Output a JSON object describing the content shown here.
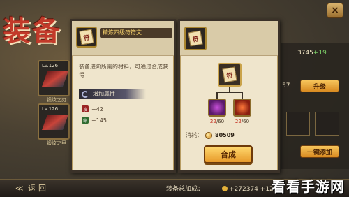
{
  "background": {
    "title": "装备",
    "close_symbol": "×",
    "slots": [
      {
        "level": "Lv.126",
        "name": "锻纹之刃"
      },
      {
        "level": "Lv.126",
        "name": "锻纹之甲"
      }
    ],
    "right_value": "3745",
    "right_value_bonus": "+19",
    "right_mid_value": "57",
    "upgrade_button": "升级",
    "equip_all_button": "一键添加"
  },
  "bottom_bar": {
    "back_label": "返回",
    "back_arrow": "≪",
    "bonus_label": "装备总加成：",
    "bonus_value": "+272374",
    "bonus_extra": "+12"
  },
  "watermark": "看看手游网",
  "item_panel": {
    "item_name": "精炼四级符符文",
    "icon_glyph": "符",
    "description": "装备进阶所需的材料，可通过合成获得",
    "attr_title": "增加属性",
    "attributes": [
      {
        "icon": "攻",
        "value": "+42"
      },
      {
        "icon": "命",
        "value": "+145"
      }
    ]
  },
  "craft_panel": {
    "icon_glyph": "符",
    "materials": [
      {
        "have": "22",
        "need": "/60",
        "color": "#c64fd8"
      },
      {
        "have": "22",
        "need": "/60",
        "color": "#ff7a3a"
      }
    ],
    "cost_label": "消耗：",
    "cost_value": "80509",
    "craft_button": "合成"
  }
}
